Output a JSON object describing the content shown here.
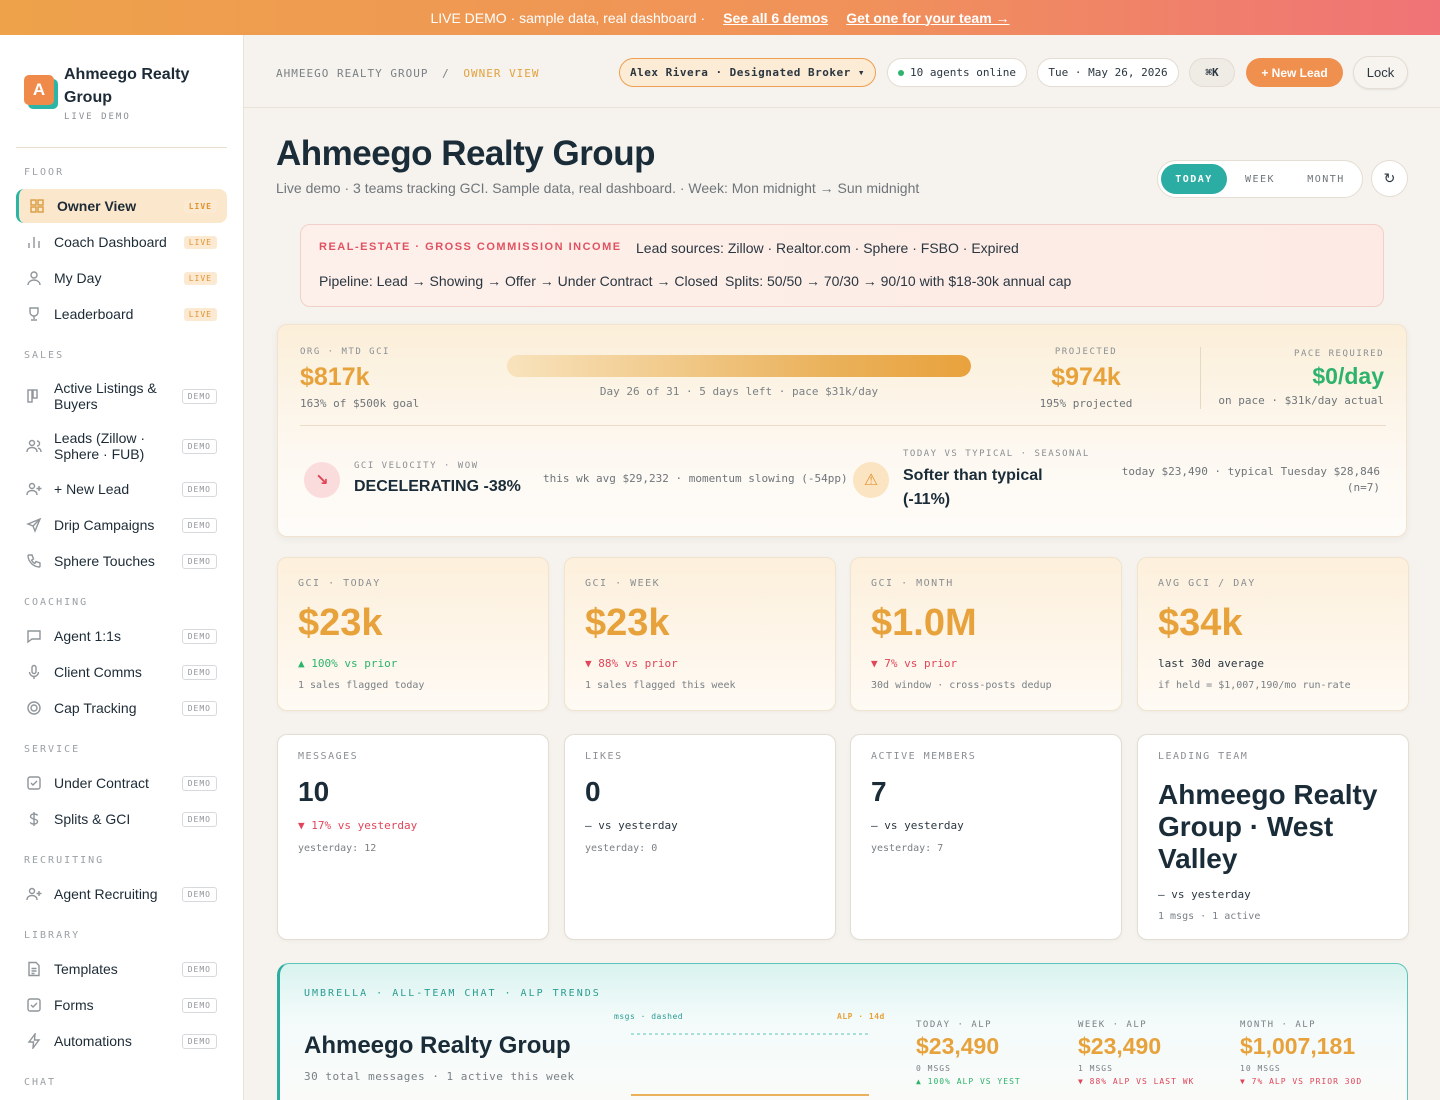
{
  "banner": {
    "text": "LIVE DEMO · sample data, real dashboard  ·",
    "link1": "See all 6 demos",
    "link2": "Get one for your team →"
  },
  "brand": {
    "logo": "A",
    "name": "Ahmeego Realty Group",
    "sub": "LIVE DEMO"
  },
  "sidebar": {
    "sections": {
      "floor": "FLOOR",
      "sales": "SALES",
      "coaching": "COACHING",
      "service": "SERVICE",
      "recruiting": "RECRUITING",
      "library": "LIBRARY",
      "chat": "CHAT"
    },
    "items": [
      {
        "label": "Owner View",
        "badge": "LIVE",
        "icon": "grid-icon"
      },
      {
        "label": "Coach Dashboard",
        "badge": "LIVE",
        "icon": "bar-chart-icon"
      },
      {
        "label": "My Day",
        "badge": "LIVE",
        "icon": "user-icon"
      },
      {
        "label": "Leaderboard",
        "badge": "LIVE",
        "icon": "trophy-icon"
      },
      {
        "label": "Active Listings & Buyers",
        "badge": "DEMO",
        "icon": "kanban-icon"
      },
      {
        "label": "Leads (Zillow · Sphere · FUB)",
        "badge": "DEMO",
        "icon": "users-icon"
      },
      {
        "label": "+ New Lead",
        "badge": "DEMO",
        "icon": "user-plus-icon"
      },
      {
        "label": "Drip Campaigns",
        "badge": "DEMO",
        "icon": "send-icon"
      },
      {
        "label": "Sphere Touches",
        "badge": "DEMO",
        "icon": "phone-icon"
      },
      {
        "label": "Agent 1:1s",
        "badge": "DEMO",
        "icon": "message-icon"
      },
      {
        "label": "Client Comms",
        "badge": "DEMO",
        "icon": "mic-icon"
      },
      {
        "label": "Cap Tracking",
        "badge": "DEMO",
        "icon": "target-icon"
      },
      {
        "label": "Under Contract",
        "badge": "DEMO",
        "icon": "check-square-icon"
      },
      {
        "label": "Splits & GCI",
        "badge": "DEMO",
        "icon": "dollar-icon"
      },
      {
        "label": "Agent Recruiting",
        "badge": "DEMO",
        "icon": "user-plus-icon"
      },
      {
        "label": "Templates",
        "badge": "DEMO",
        "icon": "file-icon"
      },
      {
        "label": "Forms",
        "badge": "DEMO",
        "icon": "check-square-icon"
      },
      {
        "label": "Automations",
        "badge": "DEMO",
        "icon": "bolt-icon"
      }
    ]
  },
  "header": {
    "crumb_root": "AHMEEGO REALTY GROUP",
    "crumb_sep": "/",
    "crumb_current": "OWNER VIEW",
    "user": "Alex Rivera · Designated Broker ▾",
    "online": "10 agents online",
    "date": "Tue · May 26, 2026",
    "kbd": "⌘K",
    "new_lead": "+ New Lead",
    "lock": "Lock"
  },
  "page": {
    "title": "Ahmeego Realty Group",
    "subtitle": "Live demo · 3 teams tracking GCI. Sample data, real dashboard. · Week: Mon midnight → Sun midnight",
    "range": [
      "TODAY",
      "WEEK",
      "MONTH"
    ],
    "range_selected": "TODAY",
    "refresh": "↻"
  },
  "info": {
    "tag": "REAL-ESTATE · GROSS COMMISSION INCOME",
    "lead_sources": "Lead sources: Zillow · Realtor.com · Sphere · FSBO · Expired",
    "pipeline": "Pipeline: Lead → Showing → Offer → Under Contract → Closed",
    "splits": "Splits: 50/50 → 70/30 → 90/10 with $18-30k annual cap"
  },
  "org": {
    "label": "ORG · MTD GCI",
    "value": "$817k",
    "goal": "163% of $500k goal",
    "progress_pct": 100,
    "progress_caption": "Day 26 of 31 · 5 days left · pace $31k/day",
    "projected_label": "PROJECTED",
    "projected_value": "$974k",
    "projected_sub": "195% projected",
    "pace_label": "PACE REQUIRED",
    "pace_value": "$0/day",
    "pace_sub": "on pace · $31k/day actual",
    "velocity_icon": "↘",
    "velocity_label": "GCI VELOCITY · WOW",
    "velocity_value": "DECELERATING -38%",
    "velocity_detail": "this wk avg $29,232 · momentum slowing (-54pp)",
    "typical_icon": "⚠",
    "typical_label": "TODAY VS TYPICAL · SEASONAL",
    "typical_value": "Softer than typical (-11%)",
    "typical_detail": "today $23,490 · typical Tuesday $28,846 (n=7)"
  },
  "cards": [
    {
      "key": "GCI · TODAY",
      "value": "$23k",
      "delta": "▲ 100% vs prior",
      "dir": "up",
      "note": "1 sales flagged today"
    },
    {
      "key": "GCI · WEEK",
      "value": "$23k",
      "delta": "▼ 88% vs prior",
      "dir": "dn",
      "note": "1 sales flagged this week"
    },
    {
      "key": "GCI · MONTH",
      "value": "$1.0M",
      "delta": "▼ 7% vs prior",
      "dir": "dn",
      "note": "30d window · cross-posts dedup"
    },
    {
      "key": "AVG GCI / DAY",
      "value": "$34k",
      "delta": "last 30d average",
      "dir": "neu",
      "note": "if held = $1,007,190/mo run-rate"
    }
  ],
  "cards2": [
    {
      "key": "MESSAGES",
      "value": "10",
      "delta": "▼ 17% vs yesterday",
      "dir": "dn",
      "note": "yesterday: 12"
    },
    {
      "key": "LIKES",
      "value": "0",
      "delta": "— vs yesterday",
      "dir": "neu",
      "note": "yesterday: 0"
    },
    {
      "key": "ACTIVE MEMBERS",
      "value": "7",
      "delta": "— vs yesterday",
      "dir": "neu",
      "note": "yesterday: 7"
    },
    {
      "key": "LEADING TEAM",
      "value": "Ahmeego Realty Group · West Valley",
      "delta": "— vs yesterday",
      "dir": "neu",
      "note": "1 msgs · 1 active"
    }
  ],
  "umbrella": {
    "label": "UMBRELLA · ALL-TEAM CHAT · ALP TRENDS",
    "title": "Ahmeego Realty Group",
    "sub": "30 total messages · 1 active this week",
    "msgs_legend": "msgs · dashed",
    "alp_legend": "ALP · 14d",
    "kpis": [
      {
        "label": "TODAY · ALP",
        "value": "$23,490",
        "msgs": "0 MSGS",
        "delta": "▲ 100% ALP VS YEST",
        "dir": "up"
      },
      {
        "label": "WEEK · ALP",
        "value": "$23,490",
        "msgs": "1 MSGS",
        "delta": "▼ 88% ALP VS LAST WK",
        "dir": "dn"
      },
      {
        "label": "MONTH · ALP",
        "value": "$1,007,181",
        "msgs": "10 MSGS",
        "delta": "▼ 7% ALP VS PRIOR 30D",
        "dir": "dn"
      }
    ]
  },
  "colors": {
    "accent_orange": "#e8a23b",
    "teal": "#2bada3",
    "up": "#2db36b",
    "down": "#e0455a"
  }
}
